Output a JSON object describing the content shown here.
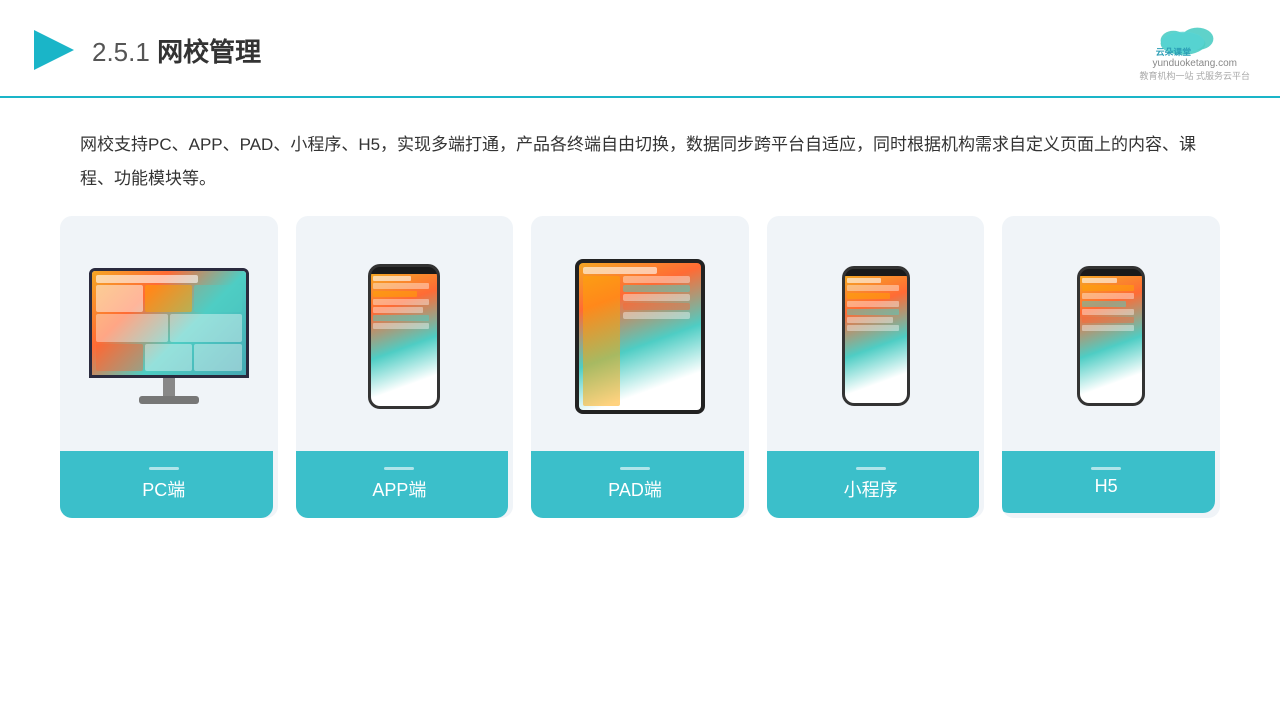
{
  "header": {
    "title": "网校管理",
    "number": "2.5.1",
    "logo_name": "云朵课堂",
    "logo_url": "yunduoketang.com",
    "logo_tagline": "教育机构一站",
    "logo_tagline2": "式服务云平台"
  },
  "description": "网校支持PC、APP、PAD、小程序、H5，实现多端打通，产品各终端自由切换，数据同步跨平台自适应，同时根据机构需求自定义页面上的内容、课程、功能模块等。",
  "cards": [
    {
      "label": "PC端",
      "type": "pc"
    },
    {
      "label": "APP端",
      "type": "phone"
    },
    {
      "label": "PAD端",
      "type": "tablet"
    },
    {
      "label": "小程序",
      "type": "phone2"
    },
    {
      "label": "H5",
      "type": "phone3"
    }
  ]
}
